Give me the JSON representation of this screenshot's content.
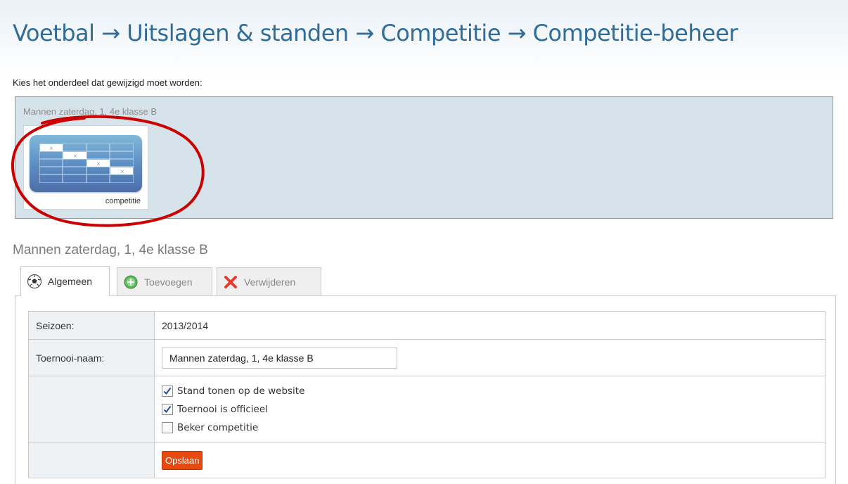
{
  "header": {
    "title": "Voetbal → Uitslagen & standen → Competitie → Competitie-beheer"
  },
  "selector": {
    "instruction": "Kies het onderdeel dat gewijzigd moet worden:",
    "group_label": "Mannen zaterdag, 1, 4e klasse B",
    "tile_label": "competitie",
    "tile_icon": "competition-table-icon"
  },
  "section": {
    "heading": "Mannen zaterdag, 1, 4e klasse B"
  },
  "tabs": [
    {
      "label": "Algemeen",
      "icon": "football-icon",
      "active": true
    },
    {
      "label": "Toevoegen",
      "icon": "add-icon",
      "active": false
    },
    {
      "label": "Verwijderen",
      "icon": "delete-icon",
      "active": false
    }
  ],
  "form": {
    "season_label": "Seizoen:",
    "season_value": "2013/2014",
    "name_label": "Toernooi-naam:",
    "name_value": "Mannen zaterdag, 1, 4e klasse B",
    "options": [
      {
        "label": "Stand tonen op de website",
        "checked": true
      },
      {
        "label": "Toernooi is officieel",
        "checked": true
      },
      {
        "label": "Beker competitie",
        "checked": false
      }
    ],
    "save_label": "Opslaan"
  },
  "colors": {
    "title": "#2f6c98",
    "panel_background": "#d6e3ea",
    "save_button": "#e8490f",
    "annotation": "#cc0000"
  }
}
